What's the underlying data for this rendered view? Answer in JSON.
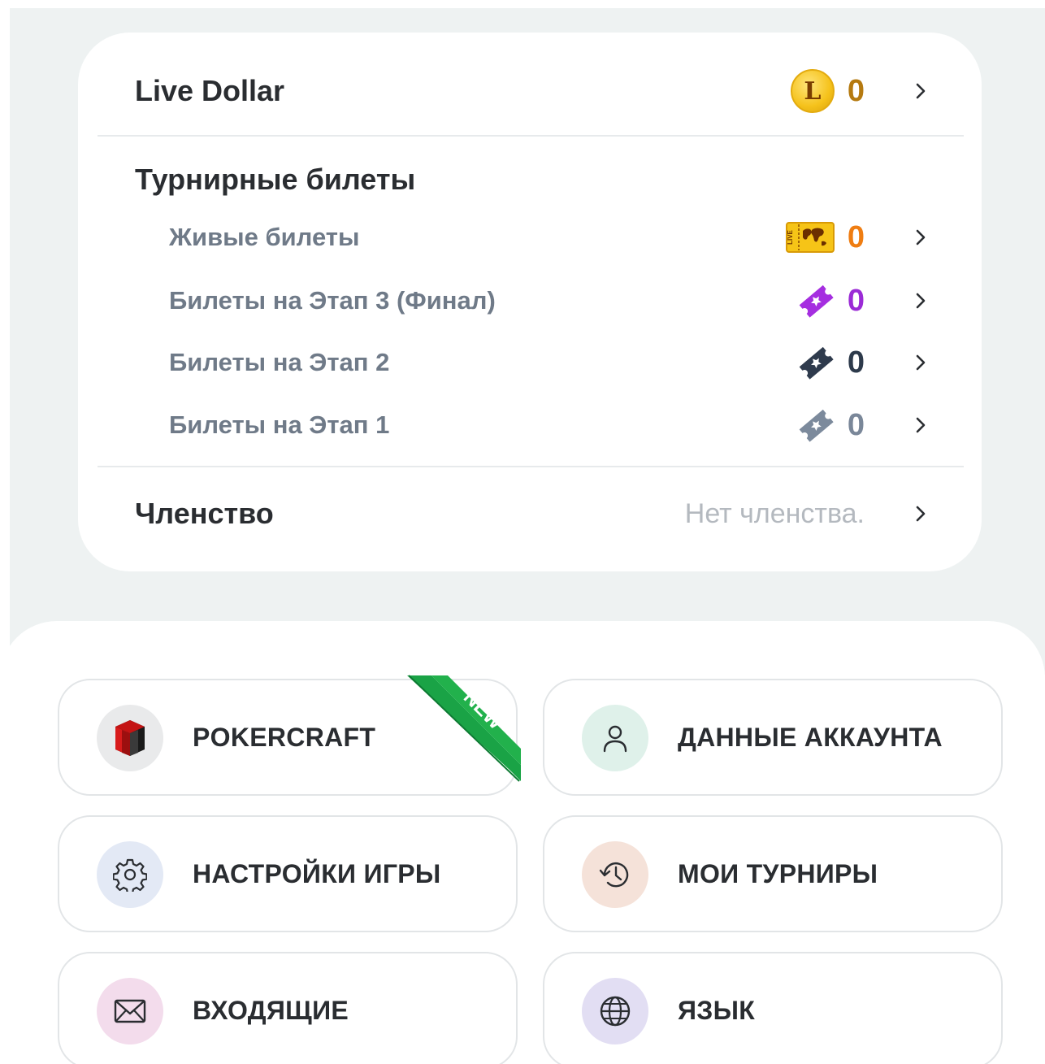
{
  "wallet": {
    "live_dollar": {
      "label": "Live Dollar",
      "coin_letter": "L",
      "value": "0",
      "value_color": "#b57a10"
    },
    "tickets": {
      "title": "Турнирные билеты",
      "items": [
        {
          "label": "Живые билеты",
          "icon": "live-ticket-icon",
          "value": "0",
          "value_color": "#ef7d12"
        },
        {
          "label": "Билеты на Этап 3 (Финал)",
          "icon": "ticket-purple-icon",
          "value": "0",
          "value_color": "#9b2bd6"
        },
        {
          "label": "Билеты на Этап 2",
          "icon": "ticket-dark-icon",
          "value": "0",
          "value_color": "#2d3a4b"
        },
        {
          "label": "Билеты на Этап 1",
          "icon": "ticket-gray-icon",
          "value": "0",
          "value_color": "#7a8799"
        }
      ]
    },
    "membership": {
      "label": "Членство",
      "status": "Нет членства."
    }
  },
  "menu": {
    "new_badge": "NEW",
    "tiles": [
      {
        "label": "POKERCRAFT",
        "icon": "pokercraft-logo-icon",
        "bg": "#e9eaeb"
      },
      {
        "label": "ДАННЫЕ АККАУНТА",
        "icon": "user-icon",
        "bg": "#dff1ea"
      },
      {
        "label": "НАСТРОЙКИ ИГРЫ",
        "icon": "gear-icon",
        "bg": "#e3e9f5"
      },
      {
        "label": "МОИ ТУРНИРЫ",
        "icon": "history-icon",
        "bg": "#f5e2d9"
      },
      {
        "label": "ВХОДЯЩИЕ",
        "icon": "mail-icon",
        "bg": "#f3dcec"
      },
      {
        "label": "ЯЗЫК",
        "icon": "globe-icon",
        "bg": "#e2def3"
      }
    ]
  }
}
